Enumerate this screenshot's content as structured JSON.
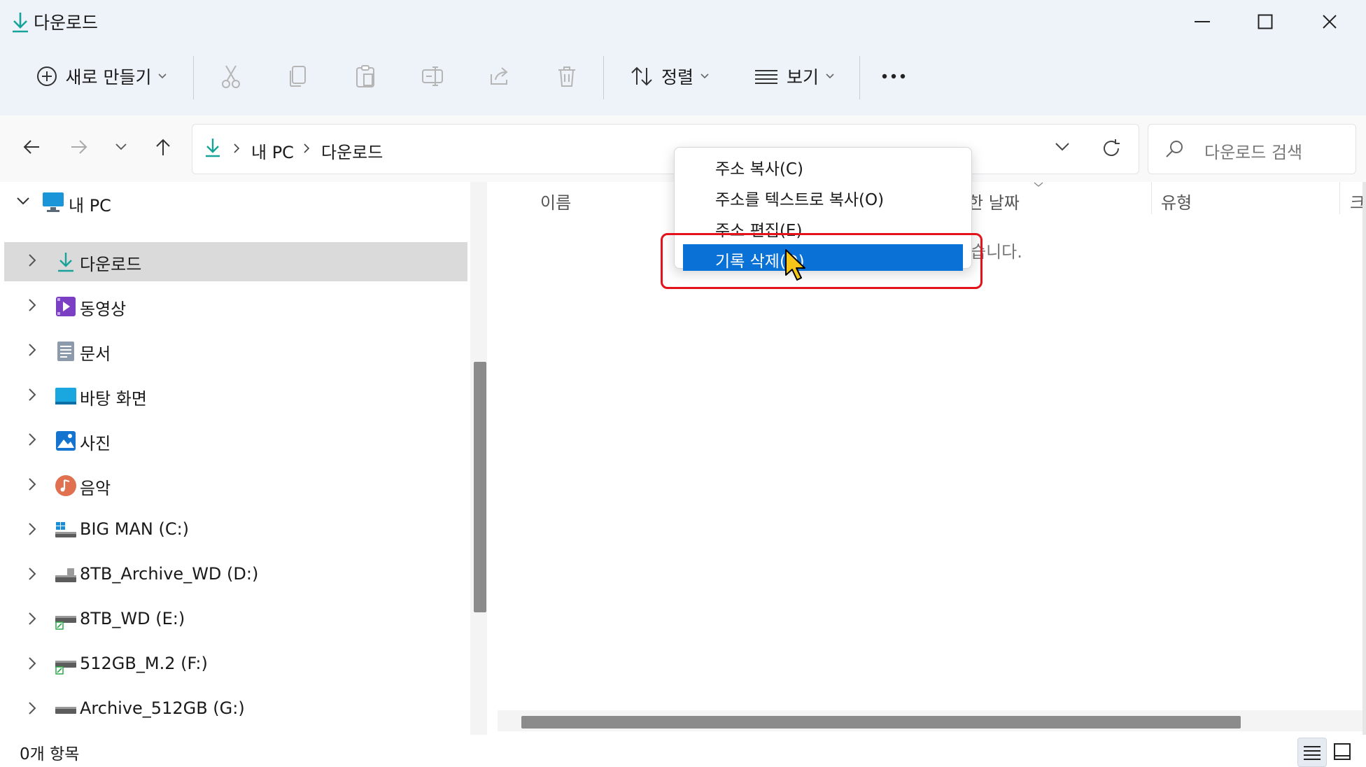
{
  "window": {
    "title": "다운로드",
    "icon": "download-arrow-icon"
  },
  "toolbar": {
    "new_label": "새로 만들기",
    "sort_label": "정렬",
    "view_label": "보기",
    "more_icon": "more-icon"
  },
  "nav": {
    "crumbs": [
      "내 PC",
      "다운로드"
    ],
    "search_placeholder": "다운로드 검색"
  },
  "sidebar": {
    "root_label": "내 PC",
    "items": [
      {
        "label": "다운로드",
        "icon": "download-arrow-icon",
        "selected": true
      },
      {
        "label": "동영상",
        "icon": "video-icon"
      },
      {
        "label": "문서",
        "icon": "document-icon"
      },
      {
        "label": "바탕 화면",
        "icon": "desktop-icon"
      },
      {
        "label": "사진",
        "icon": "picture-icon"
      },
      {
        "label": "음악",
        "icon": "music-icon"
      },
      {
        "label": "BIG MAN (C:)",
        "icon": "windows-drive-icon"
      },
      {
        "label": "8TB_Archive_WD (D:)",
        "icon": "drive-icon"
      },
      {
        "label": "8TB_WD (E:)",
        "icon": "drive-icon"
      },
      {
        "label": "512GB_M.2 (F:)",
        "icon": "drive-icon"
      },
      {
        "label": "Archive_512GB (G:)",
        "icon": "drive-icon"
      }
    ]
  },
  "content": {
    "columns": [
      "이름",
      "한 날짜",
      "유형",
      "크"
    ],
    "empty_fragment": "습니다."
  },
  "status": {
    "item_count": "0개 항목"
  },
  "context_menu": {
    "items": [
      "주소 복사(C)",
      "주소를 텍스트로 복사(O)",
      "주소 편집(E)",
      "기록 삭제(D)"
    ],
    "highlighted_index": 3
  },
  "colors": {
    "accent": "#0a72d7",
    "highlight_box": "#e3121b",
    "download_icon": "#17a39a"
  }
}
